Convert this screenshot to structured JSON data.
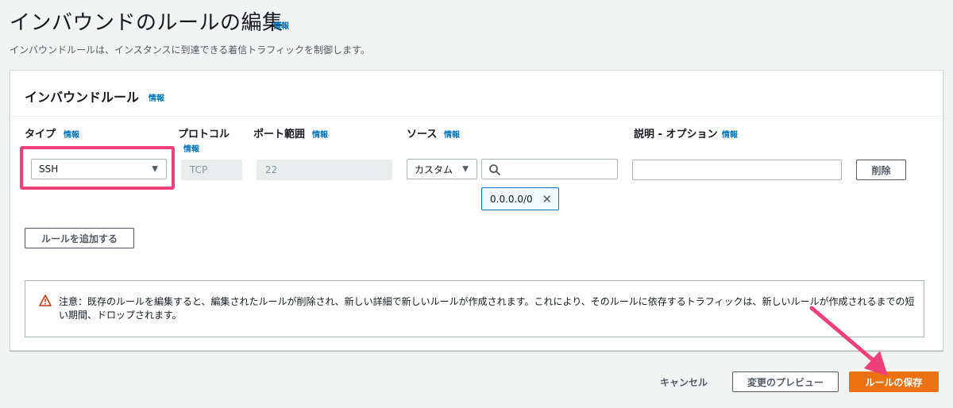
{
  "page": {
    "title": "インバウンドのルールの編集",
    "title_info": "情報",
    "description": "インバウンドルールは、インスタンスに到達できる着信トラフィックを制御します。"
  },
  "panel": {
    "title": "インバウンドルール",
    "title_info": "情報"
  },
  "columns": {
    "type": {
      "label": "タイプ",
      "info": "情報"
    },
    "protocol": {
      "label": "プロトコル",
      "info": "情報"
    },
    "port_range": {
      "label": "ポート範囲",
      "info": "情報"
    },
    "source": {
      "label": "ソース",
      "info": "情報"
    },
    "description": {
      "label": "説明 - オプション",
      "info": "情報"
    }
  },
  "rule": {
    "type_value": "SSH",
    "protocol_value": "TCP",
    "port_value": "22",
    "source_select": "カスタム",
    "source_search_value": "",
    "source_token": "0.0.0.0/0",
    "description_value": "",
    "delete_label": "削除"
  },
  "add_rule_label": "ルールを追加する",
  "alert": {
    "text": "注意：既存のルールを編集すると、編集されたルールが削除され、新しい詳細で新しいルールが作成されます。これにより、そのルールに依存するトラフィックは、新しいルールが作成されるまでの短い期間、ドロップされます。",
    "icon": "warning-icon"
  },
  "footer": {
    "cancel_label": "キャンセル",
    "preview_label": "変更のプレビュー",
    "save_label": "ルールの保存"
  },
  "colors": {
    "accent": "#0073bb",
    "primary_button": "#ec7211",
    "annotation": "#f0407a"
  }
}
